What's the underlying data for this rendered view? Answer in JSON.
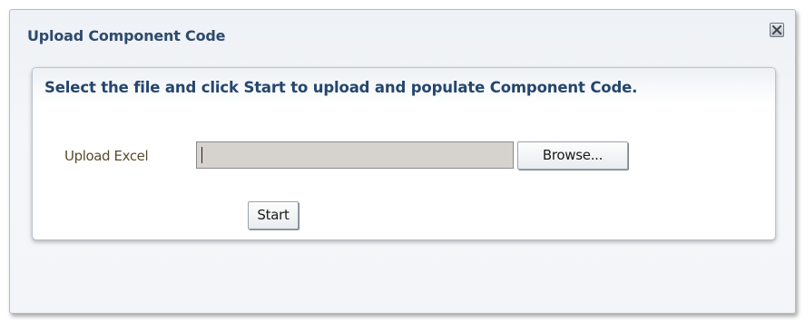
{
  "dialog": {
    "title": "Upload Component Code",
    "close_icon": "close-icon"
  },
  "panel": {
    "heading": "Select the file and click Start to upload and populate Component Code."
  },
  "upload": {
    "label": "Upload Excel",
    "value": "",
    "browse_label": "Browse..."
  },
  "actions": {
    "start_label": "Start"
  }
}
